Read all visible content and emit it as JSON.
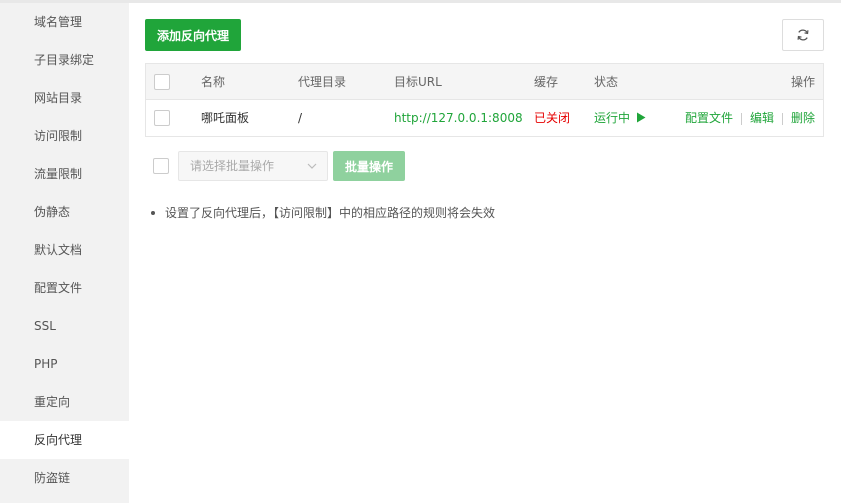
{
  "sidebar": {
    "items": [
      {
        "label": "域名管理"
      },
      {
        "label": "子目录绑定"
      },
      {
        "label": "网站目录"
      },
      {
        "label": "访问限制"
      },
      {
        "label": "流量限制"
      },
      {
        "label": "伪静态"
      },
      {
        "label": "默认文档"
      },
      {
        "label": "配置文件"
      },
      {
        "label": "SSL"
      },
      {
        "label": "PHP"
      },
      {
        "label": "重定向"
      },
      {
        "label": "反向代理"
      },
      {
        "label": "防盗链"
      }
    ],
    "active": "反向代理"
  },
  "toolbar": {
    "add_label": "添加反向代理",
    "refresh_icon": "refresh-icon"
  },
  "table": {
    "headers": {
      "name": "名称",
      "dir": "代理目录",
      "url": "目标URL",
      "cache": "缓存",
      "status": "状态",
      "actions": "操作"
    },
    "rows": [
      {
        "name": "哪吒面板",
        "dir": "/",
        "url": "http://127.0.0.1:8008",
        "cache": "已关闭",
        "status": "运行中",
        "status_icon": "play-icon",
        "actions": {
          "config": "配置文件",
          "edit": "编辑",
          "delete": "删除"
        }
      }
    ]
  },
  "batch": {
    "placeholder": "请选择批量操作",
    "button_label": "批量操作"
  },
  "tips": [
    "设置了反向代理后，【访问限制】中的相应路径的规则将会失效"
  ],
  "colors": {
    "accent": "#20a53a",
    "danger": "#e60000",
    "accent_disabled": "#8fd19e",
    "sidebar_bg": "#f2f2f2"
  }
}
